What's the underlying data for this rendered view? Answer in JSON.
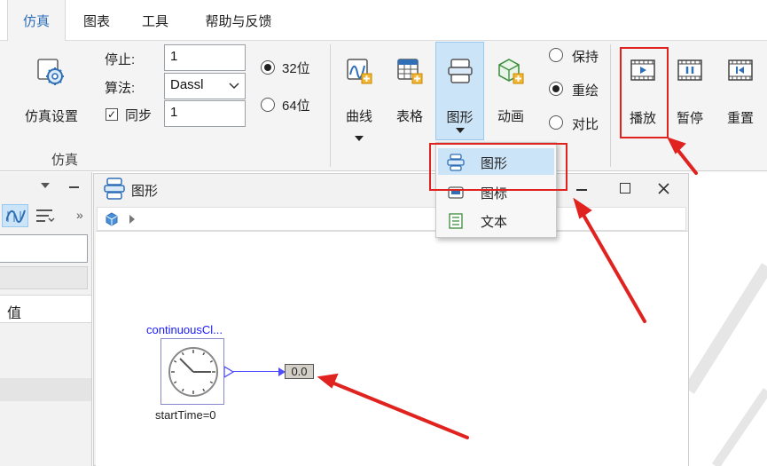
{
  "tabs": [
    "仿真",
    "图表",
    "工具",
    "帮助与反馈"
  ],
  "active_tab": "仿真",
  "sim_group": {
    "settings_label": "仿真设置",
    "group_label": "仿真",
    "stop_label": "停止:",
    "stop_value": "1",
    "algorithm_label": "算法:",
    "algorithm_value": "Dassl",
    "sync_label": "同步",
    "sync_checked": true,
    "sync_value": "1",
    "bits_32": "32位",
    "bits_64": "64位",
    "bits_selected": "32位"
  },
  "chart_group": {
    "curve_label": "曲线",
    "table_label": "表格",
    "graphic_label": "图形",
    "animation_label": "动画"
  },
  "mode_group": {
    "hold_label": "保持",
    "redraw_label": "重绘",
    "compare_label": "对比",
    "selected": "重绘"
  },
  "playback": {
    "play_label": "播放",
    "pause_label": "暂停",
    "reset_label": "重置"
  },
  "dropdown": {
    "items": [
      "图形",
      "图标",
      "文本"
    ],
    "highlighted": "图形"
  },
  "left_panel": {
    "value_header": "值",
    "more": "»"
  },
  "figure_window": {
    "title": "图形",
    "block_name": "continuousCl...",
    "block_param": "startTime=0",
    "display_value": "0.0"
  },
  "colors": {
    "accent": "#2e6fb7",
    "highlight_red": "#e0231f",
    "selected_item": "#cce4f7",
    "graphic_button_bg": "#cce4f7"
  }
}
